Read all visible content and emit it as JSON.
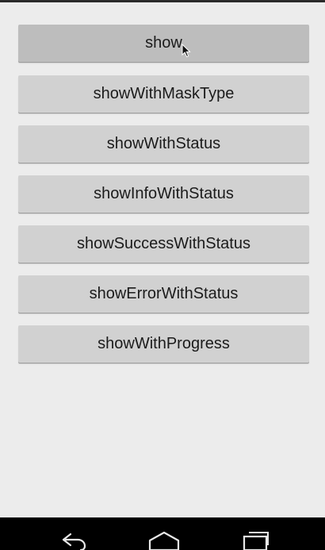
{
  "buttons": [
    {
      "label": "show"
    },
    {
      "label": "showWithMaskType"
    },
    {
      "label": "showWithStatus"
    },
    {
      "label": "showInfoWithStatus"
    },
    {
      "label": "showSuccessWithStatus"
    },
    {
      "label": "showErrorWithStatus"
    },
    {
      "label": "showWithProgress"
    }
  ],
  "nav": {
    "back_icon": "back-arrow-icon",
    "home_icon": "home-icon",
    "recents_icon": "recent-apps-icon"
  },
  "colors": {
    "background": "#ececec",
    "button": "#d1d1d1",
    "button_pressed": "#bdbdbd",
    "navbar": "#000000"
  }
}
